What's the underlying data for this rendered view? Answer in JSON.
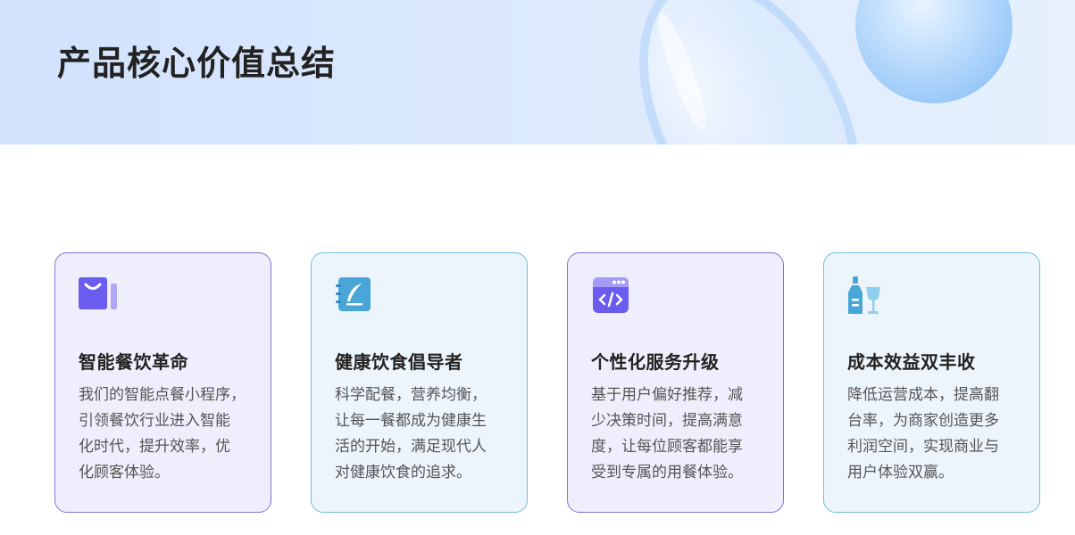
{
  "page": {
    "title": "产品核心价值总结"
  },
  "cards": [
    {
      "icon": "shopping-bag-icon",
      "title": "智能餐饮革命",
      "lines": [
        "我们的智能点餐小程序，",
        "引领餐饮行业进入智能",
        "化时代，提升效率，优",
        "化顾客体验。"
      ]
    },
    {
      "icon": "notebook-quill-icon",
      "title": "健康饮食倡导者",
      "lines": [
        "科学配餐，营养均衡，",
        "让每一餐都成为健康生",
        "活的开始，满足现代人",
        "对健康饮食的追求。"
      ]
    },
    {
      "icon": "code-window-icon",
      "title": "个性化服务升级",
      "lines": [
        "基于用户偏好推荐，减",
        "少决策时间，提高满意",
        "度，让每位顾客都能享",
        "受到专属的用餐体验。"
      ]
    },
    {
      "icon": "bottle-glass-icon",
      "title": "成本效益双丰收",
      "lines": [
        "降低运营成本，提高翻",
        "台率，为商家创造更多",
        "利润空间，实现商业与",
        "用户体验双赢。"
      ]
    }
  ],
  "colors": {
    "purple_accent": "#6b5cf0",
    "blue_accent": "#4aa6d9",
    "title_text": "#222222",
    "body_text": "#555555"
  }
}
